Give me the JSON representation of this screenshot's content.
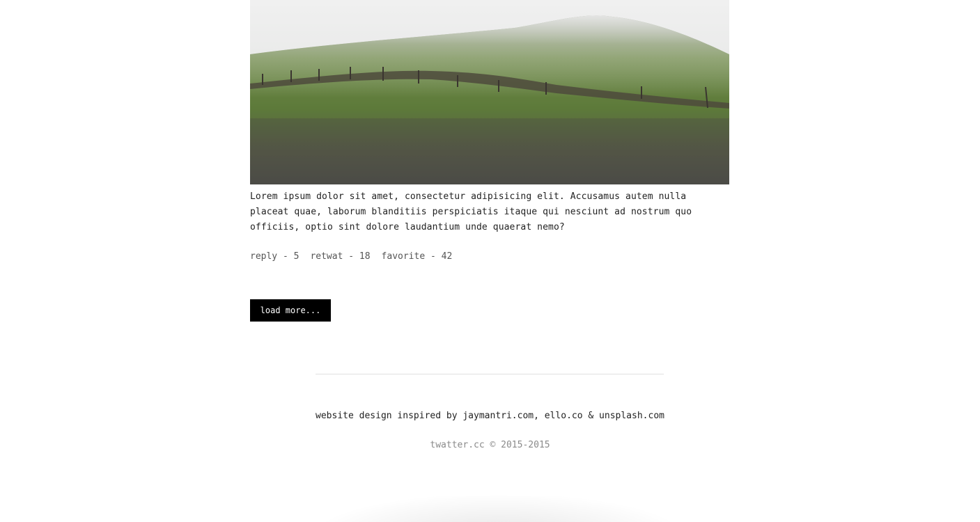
{
  "post": {
    "image_icon": "landscape-photo",
    "text": "Lorem ipsum dolor sit amet, consectetur adipisicing elit. Accusamus autem nulla placeat quae, laborum blanditiis perspiciatis itaque qui nesciunt ad nostrum quo officiis, optio sint dolore laudantium unde quaerat nemo?",
    "actions": {
      "reply": "reply - 5",
      "retweet": "retwat - 18",
      "favorite": "favorite - 42"
    }
  },
  "load_more_label": "load more...",
  "footer": {
    "credits_prefix": "website design inspired by ",
    "link1": "jaymantri.com",
    "sep1": ", ",
    "link2": "ello.co",
    "sep2": " & ",
    "link3": "unsplash.com",
    "copyright": "twatter.cc © 2015-2015"
  },
  "colors": {
    "button_bg": "#000000",
    "text": "#222222",
    "muted": "#8a8a8a"
  }
}
